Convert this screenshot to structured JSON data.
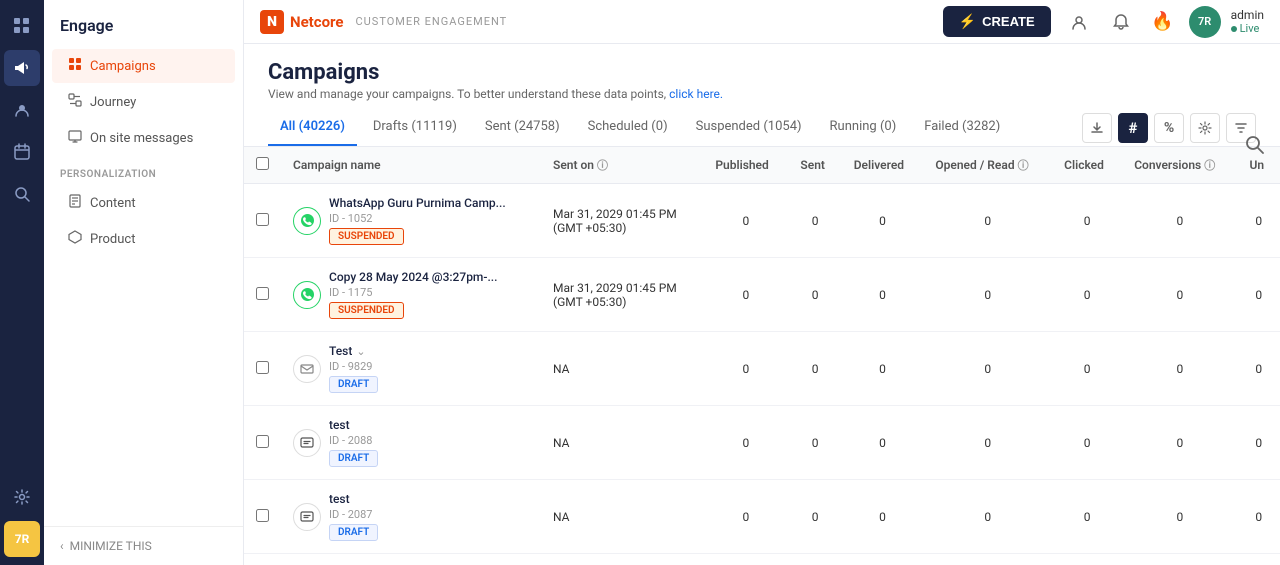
{
  "topbar": {
    "logo": "N",
    "brand": "Netcore",
    "subtitle": "CUSTOMER ENGAGEMENT",
    "create_label": "CREATE",
    "admin_label": "admin",
    "admin_status": "Live",
    "admin_avatar": "7R"
  },
  "sidebar": {
    "title": "Engage",
    "nav_items": [
      {
        "id": "campaigns",
        "label": "Campaigns",
        "active": true
      },
      {
        "id": "journey",
        "label": "Journey",
        "active": false
      },
      {
        "id": "onsite",
        "label": "On site messages",
        "active": false
      }
    ],
    "personalization_label": "PERSONALIZATION",
    "personalization_items": [
      {
        "id": "content",
        "label": "Content"
      },
      {
        "id": "product",
        "label": "Product"
      }
    ],
    "minimize_label": "MINIMIZE THIS"
  },
  "page": {
    "title": "Campaigns",
    "subtitle": "View and manage your campaigns. To better understand these data points,",
    "subtitle_link": "click here."
  },
  "tabs": [
    {
      "id": "all",
      "label": "All (40226)",
      "active": true
    },
    {
      "id": "drafts",
      "label": "Drafts (11119)",
      "active": false
    },
    {
      "id": "sent",
      "label": "Sent (24758)",
      "active": false
    },
    {
      "id": "scheduled",
      "label": "Scheduled (0)",
      "active": false
    },
    {
      "id": "suspended",
      "label": "Suspended (1054)",
      "active": false
    },
    {
      "id": "running",
      "label": "Running (0)",
      "active": false
    },
    {
      "id": "failed",
      "label": "Failed (3282)",
      "active": false
    }
  ],
  "table": {
    "columns": [
      {
        "id": "checkbox",
        "label": ""
      },
      {
        "id": "name",
        "label": "Campaign name"
      },
      {
        "id": "sent_on",
        "label": "Sent on"
      },
      {
        "id": "published",
        "label": "Published"
      },
      {
        "id": "sent",
        "label": "Sent"
      },
      {
        "id": "delivered",
        "label": "Delivered"
      },
      {
        "id": "opened_read",
        "label": "Opened / Read"
      },
      {
        "id": "clicked",
        "label": "Clicked"
      },
      {
        "id": "conversions",
        "label": "Conversions"
      },
      {
        "id": "un",
        "label": "Un"
      }
    ],
    "rows": [
      {
        "id": "1052",
        "name": "WhatsApp Guru Purnima Camp...",
        "channel": "whatsapp",
        "badge": "SUSPENDED",
        "badge_type": "suspended",
        "sent_on": "Mar 31, 2029 01:45 PM\n(GMT +05:30)",
        "published": "0",
        "sent": "0",
        "delivered": "0",
        "opened_read": "0",
        "clicked": "0",
        "conversions": "0",
        "un": "0"
      },
      {
        "id": "1175",
        "name": "Copy 28 May 2024 @3:27pm-...",
        "channel": "whatsapp",
        "badge": "SUSPENDED",
        "badge_type": "suspended",
        "sent_on": "Mar 31, 2029 01:45 PM\n(GMT +05:30)",
        "published": "0",
        "sent": "0",
        "delivered": "0",
        "opened_read": "0",
        "clicked": "0",
        "conversions": "0",
        "un": "0"
      },
      {
        "id": "9829",
        "name": "Test",
        "channel": "email",
        "badge": "DRAFT",
        "badge_type": "draft",
        "sent_on": "NA",
        "published": "0",
        "sent": "0",
        "delivered": "0",
        "opened_read": "0",
        "clicked": "0",
        "conversions": "0",
        "un": "0",
        "has_dropdown": true
      },
      {
        "id": "2088",
        "name": "test",
        "channel": "sms",
        "badge": "DRAFT",
        "badge_type": "draft",
        "sent_on": "NA",
        "published": "0",
        "sent": "0",
        "delivered": "0",
        "opened_read": "0",
        "clicked": "0",
        "conversions": "0",
        "un": "0"
      },
      {
        "id": "2087",
        "name": "test",
        "channel": "sms",
        "badge": "DRAFT",
        "badge_type": "draft",
        "sent_on": "NA",
        "published": "0",
        "sent": "0",
        "delivered": "0",
        "opened_read": "0",
        "clicked": "0",
        "conversions": "0",
        "un": "0"
      }
    ]
  }
}
